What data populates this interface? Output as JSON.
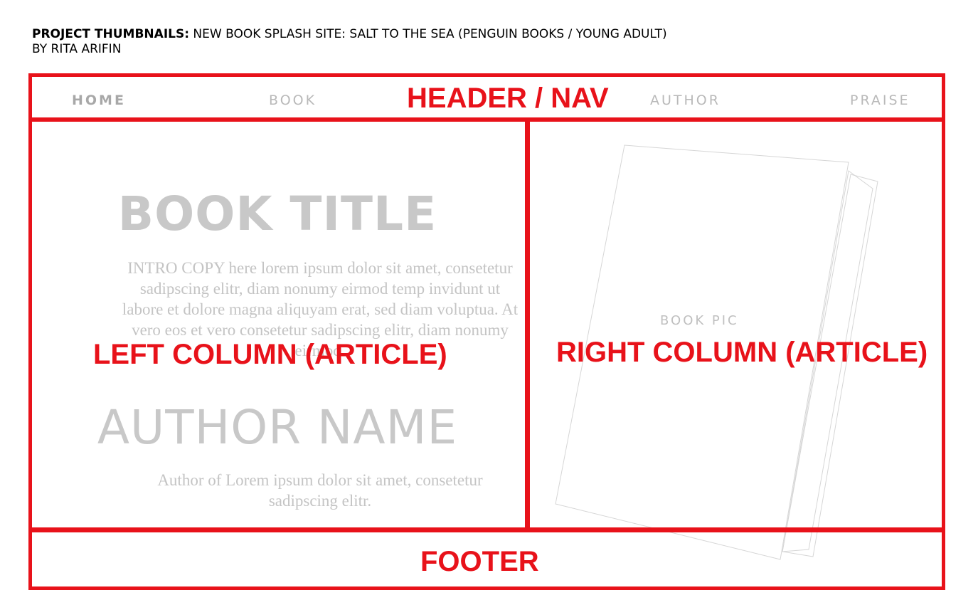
{
  "doc_header": {
    "label": "PROJECT THUMBNAILS:",
    "title": " NEW BOOK SPLASH SITE: SALT TO THE SEA (PENGUIN BOOKS / YOUNG ADULT)",
    "byline": "BY RITA ARIFIN"
  },
  "nav": {
    "items": [
      {
        "label": "HOME",
        "active": true
      },
      {
        "label": "BOOK"
      },
      {
        "label": "AUTHOR"
      },
      {
        "label": "PRAISE"
      }
    ]
  },
  "regions": {
    "header": "HEADER / NAV",
    "left": "LEFT COLUMN (ARTICLE)",
    "right": "RIGHT COLUMN (ARTICLE)",
    "footer": "FOOTER"
  },
  "left_column": {
    "book_title": "BOOK TITLE",
    "intro_copy": "INTRO COPY here lorem ipsum dolor sit amet, consetetur sadipscing elitr, diam nonumy eirmod temp invidunt  ut labore et dolore magna aliquyam erat, sed diam voluptua. At vero eos et vero consetetur sadipscing elitr, diam nonumy eirmod.",
    "author_name": "AUTHOR NAME",
    "author_bio": "Author of Lorem ipsum dolor sit amet, consetetur sadipscing elitr."
  },
  "right_column": {
    "book_pic": "BOOK PIC"
  },
  "colors": {
    "wireframe": "#e8121a",
    "placeholder_text": "#c8c8c8"
  }
}
